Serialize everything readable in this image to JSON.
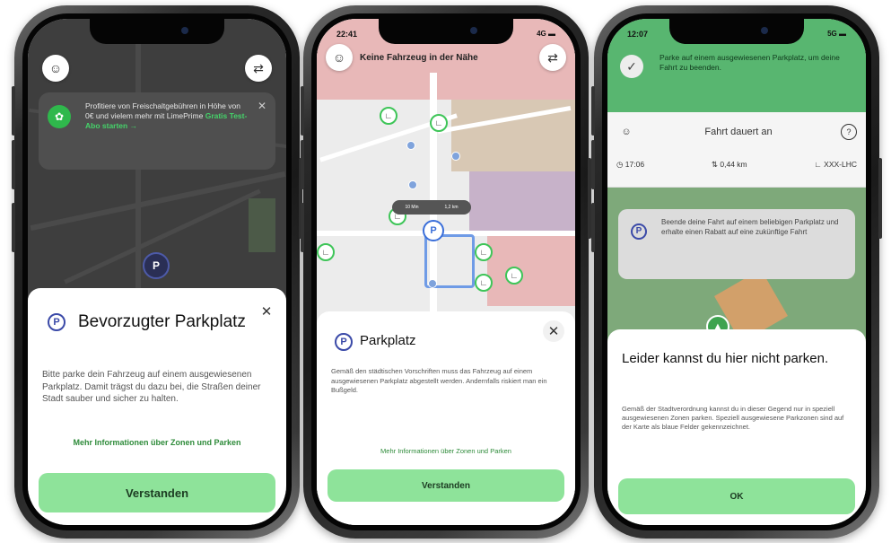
{
  "phone1": {
    "promo": {
      "text_before": "Profitiere von Freischaltgebühren in Höhe von 0€ und vielem mehr mit LimePrime",
      "text_highlight": "Gratis Test-Abo starten →"
    },
    "pin_label": "P",
    "sheet": {
      "icon_label": "P",
      "title": "Bevorzugter Parkplatz",
      "body": "Bitte parke dein Fahrzeug auf einem ausgewiesenen Parkplatz. Damit trägst du dazu bei, die Straßen deiner Stadt sauber und sicher zu halten.",
      "link": "Mehr Informationen über Zonen und Parken",
      "button": "Verstanden"
    }
  },
  "phone2": {
    "status_time": "22:41",
    "status_right": "4G ▬",
    "search_title": "Keine Fahrzeug in der Nähe",
    "tooltip_left": "10 Min",
    "tooltip_right": "1,2 km",
    "pin_label": "P",
    "sheet": {
      "icon_label": "P",
      "title": "Parkplatz",
      "body": "Gemäß den städtischen Vorschriften muss das Fahrzeug auf einem ausgewiesenen Parkplatz abgestellt werden. Andernfalls riskiert man ein Bußgeld.",
      "link": "Mehr Informationen über Zonen und Parken",
      "button": "Verstanden"
    }
  },
  "phone3": {
    "status_time": "12:07",
    "status_right": "5G ▬",
    "banner": "Parke auf einem ausgewiesenen Parkplatz, um deine Fahrt zu beenden.",
    "ride_title": "Fahrt dauert an",
    "ride_time": "17:06",
    "ride_distance": "0,44 km",
    "ride_vehicle": "XXX-LHC",
    "info_text": "Beende deine Fahrt auf einem beliebigen Parkplatz und erhalte einen Rabatt auf eine zukünftige Fahrt",
    "sheet": {
      "title": "Leider kannst du hier nicht parken.",
      "body": "Gemäß der Stadtverordnung kannst du in dieser Gegend nur in speziell ausgewiesenen Zonen parken. Speziell ausgewiesene Parkzonen sind auf der Karte als blaue Felder gekennzeichnet.",
      "button": "OK"
    }
  },
  "colors": {
    "accent_green": "#8ee39a",
    "link_green": "#2e8b3a",
    "parking_blue": "#3b4aa8",
    "banner_green": "#58b670"
  }
}
